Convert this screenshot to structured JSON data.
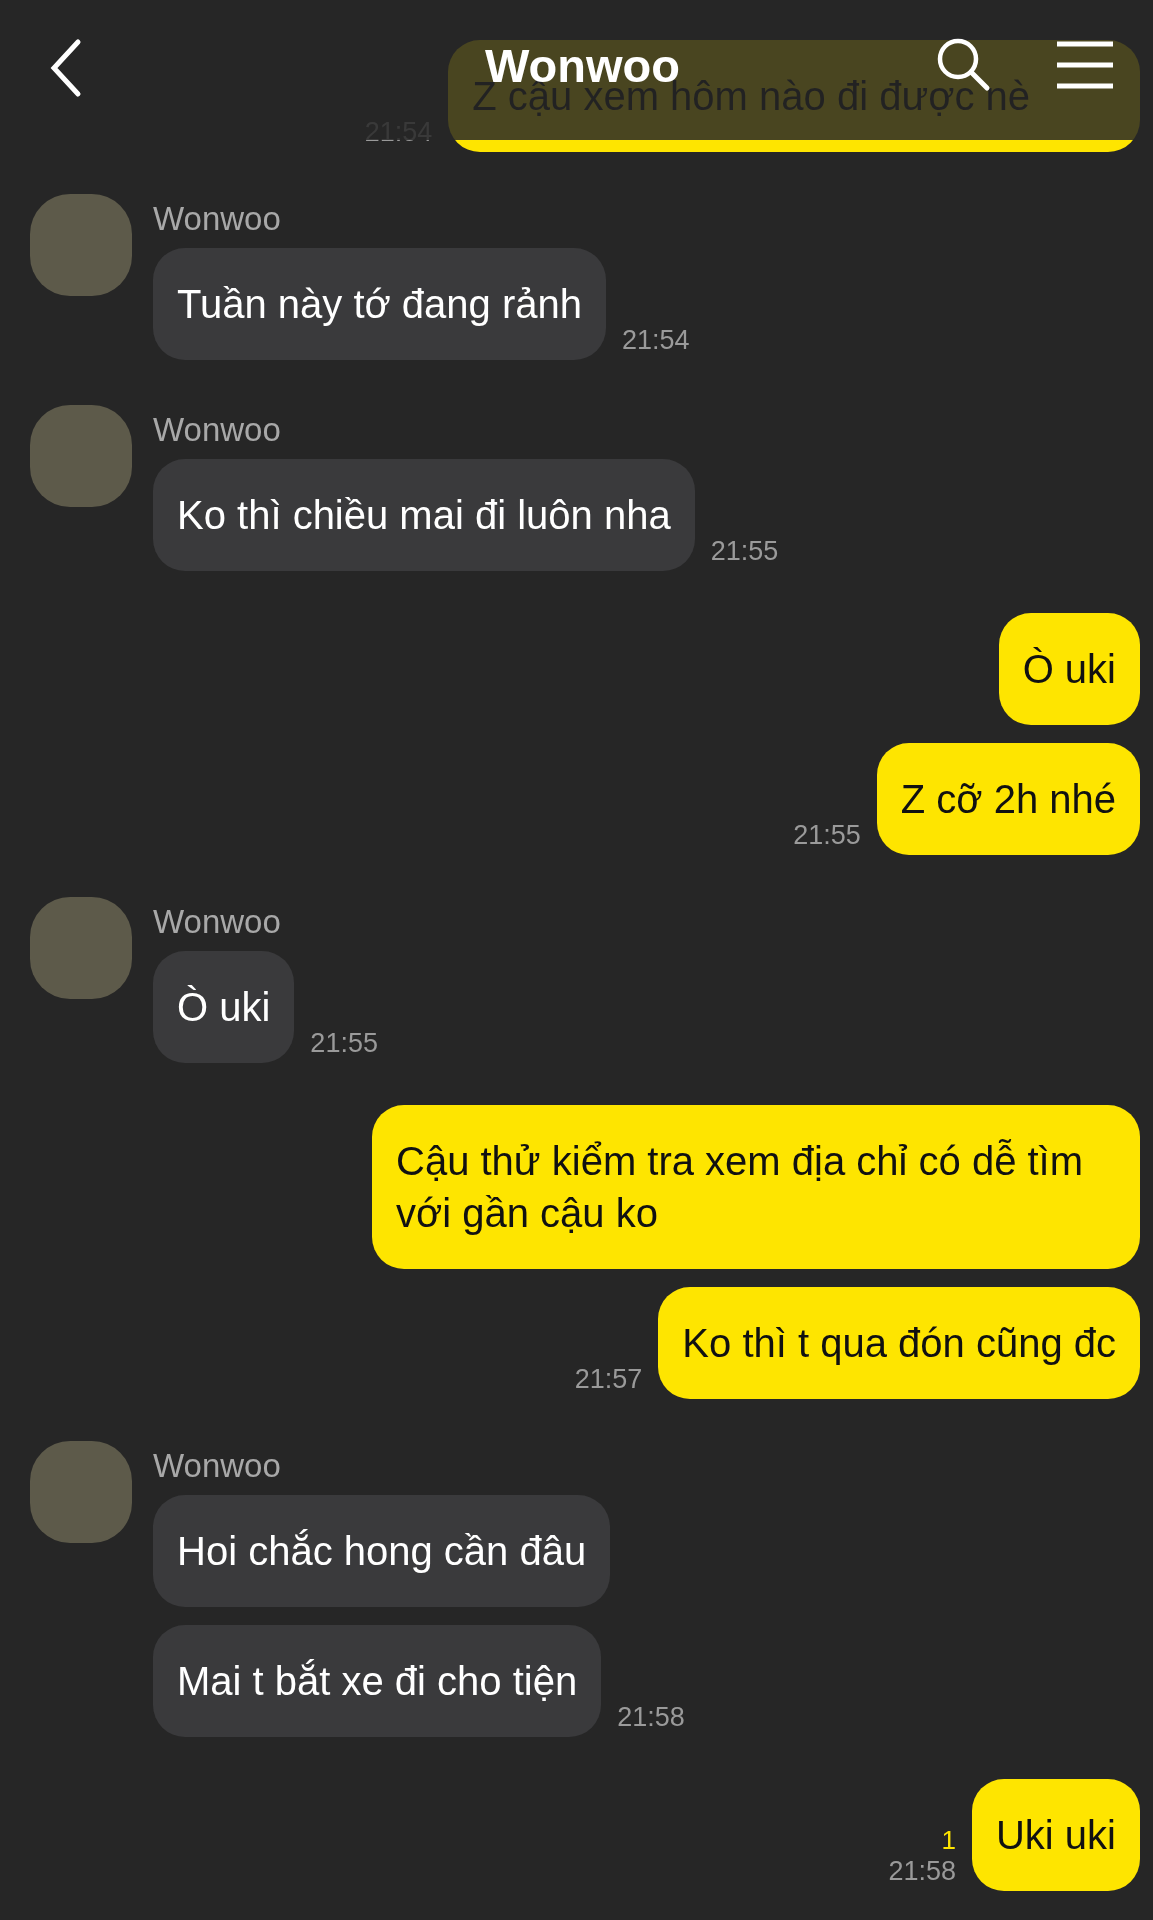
{
  "header": {
    "title": "Wonwoo"
  },
  "messages": [
    {
      "kind": "sent",
      "bubbles": [
        "Z cậu xem hôm nào đi được nè"
      ],
      "time": "21:54"
    },
    {
      "kind": "received",
      "sender": "Wonwoo",
      "bubbles": [
        "Tuần này tớ đang rảnh"
      ],
      "time": "21:54"
    },
    {
      "kind": "received",
      "sender": "Wonwoo",
      "bubbles": [
        "Ko thì chiều mai đi luôn nha"
      ],
      "time": "21:55"
    },
    {
      "kind": "sent",
      "bubbles": [
        "Ò uki",
        "Z cỡ 2h nhé"
      ],
      "time": "21:55"
    },
    {
      "kind": "received",
      "sender": "Wonwoo",
      "bubbles": [
        "Ò uki"
      ],
      "time": "21:55"
    },
    {
      "kind": "sent",
      "bubbles": [
        "Cậu thử kiểm tra xem địa chỉ có dễ tìm với gần cậu ko",
        "Ko thì t qua đón cũng đc"
      ],
      "time": "21:57"
    },
    {
      "kind": "received",
      "sender": "Wonwoo",
      "bubbles": [
        "Hoi chắc hong cần đâu",
        "Mai t bắt xe đi cho tiện"
      ],
      "time": "21:58"
    },
    {
      "kind": "sent",
      "bubbles": [
        "Uki uki"
      ],
      "time": "21:58",
      "unread": "1"
    }
  ]
}
